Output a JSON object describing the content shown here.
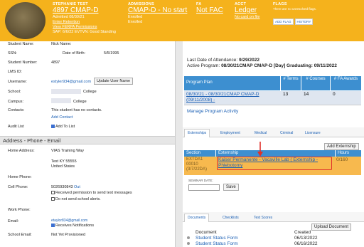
{
  "header": {
    "student_name": "STEPHANIE TEST",
    "student_id_link": "4897 CMAP-D",
    "admitted": "Admitted 08/30/21",
    "enter_retention": "Enter Retention",
    "ferpa": "View FERPA Permissions",
    "sap": "SAP: 6/6/22 EVTVN: Good Standing",
    "admissions_label": "ADMISSIONS",
    "admissions_value": "CMAP-D - No start",
    "admissions_status1": "Enrolled",
    "admissions_status2": "Enrolled",
    "fa_label": "FA",
    "fa_value": "Not FAC",
    "acct_label": "ACCT",
    "acct_value": "Ledger",
    "acct_card": "No card on file",
    "flags_label": "FLAGS",
    "flags_none": "There are no unresolved flags.",
    "add_flag": "ADD FLAG",
    "history": "HISTORY"
  },
  "left": {
    "student_name_label": "Student Name:",
    "student_name_value": "Nick Name:",
    "ssn_label": "SSN:",
    "dob_label": "Date of Birth:",
    "dob_value": "5/5/1995",
    "student_number_label": "Student Number:",
    "student_number_value": "4897",
    "lms_label": "LMS ID:",
    "username_label": "Username:",
    "username_value": "estyler934@gmail.com",
    "update_user_btn": "Update User Name",
    "school_label": "School:",
    "school_value": "College",
    "campus_label": "Campus:",
    "campus_value": "College",
    "contacts_label": "Contacts:",
    "contacts_value": "This student has no contacts.",
    "add_contact": "Add Contact",
    "audit_label": "Audit List",
    "add_to_list": "Add To List",
    "section_title": "Address - Phone - Email",
    "home_address_label": "Home Address:",
    "addr1": "VIAS Training Way",
    "addr2": "Test KY 55555",
    "addr3": "United States",
    "home_phone_label": "Home Phone:",
    "cell_phone_label": "Cell Phone:",
    "cell_phone_value": "5026930843",
    "cell_phone_link": "Out",
    "perm_text": "Received permission to send text messages",
    "no_alerts": "Do not send school alerts.",
    "work_phone_label": "Work Phone:",
    "email_label": "Email:",
    "email_value": "etaylor834@gmail.com",
    "receives_notifications": "Receives Notifications",
    "school_email_label": "School Email:",
    "school_email_value": "Not Yet Provisioned"
  },
  "right": {
    "last_attendance_label": "Last Date of Attendance:",
    "last_attendance_value": "9/29/2022",
    "active_program_label": "Active Program:",
    "active_program_value": "08/30/21CMAP CMAP-D [Day] Graduating: 09/11/2022",
    "program_table": {
      "headers": [
        "Program Plan",
        "# Terms",
        "# Courses",
        "# FA Awards"
      ],
      "rows": [
        {
          "plan": "08/30/21 - 08/30/21CMAP CMAP-D (09/11/2008) -",
          "terms": "13",
          "courses": "14",
          "fa": "0"
        }
      ]
    },
    "manage_program": "Manage Program Activity",
    "tabs": [
      "Externships",
      "Employment",
      "Medical",
      "Criminal",
      "Licensure"
    ],
    "add_externship": "Add Externship",
    "ext_table": {
      "headers": [
        "Section",
        "Externship",
        "Hours"
      ],
      "rows": [
        {
          "section": "EXTDA1 00010 (3/7/22DA)",
          "externship": "Kaiser Permanente - Vacaville Lab ( Externship - Phlebotomy",
          "hours": "0/160"
        }
      ]
    },
    "seminar_label": "SEMINAR DATE:",
    "save_btn": "Save",
    "doc_tabs": [
      "Documents",
      "Checklists",
      "Test Scores"
    ],
    "upload_doc": "Upload Document",
    "doc_headers": [
      "Document",
      "Created"
    ],
    "docs": [
      {
        "name": "Student Status Form",
        "created": "06/13/2022"
      },
      {
        "name": "Student Status Form",
        "created": "06/16/2022"
      }
    ],
    "colors": {
      "header_bg": "#f5b21c",
      "table_header": "#3d8fd0",
      "highlight_row": "#f7b94e",
      "annotation": "#e0302a"
    }
  }
}
